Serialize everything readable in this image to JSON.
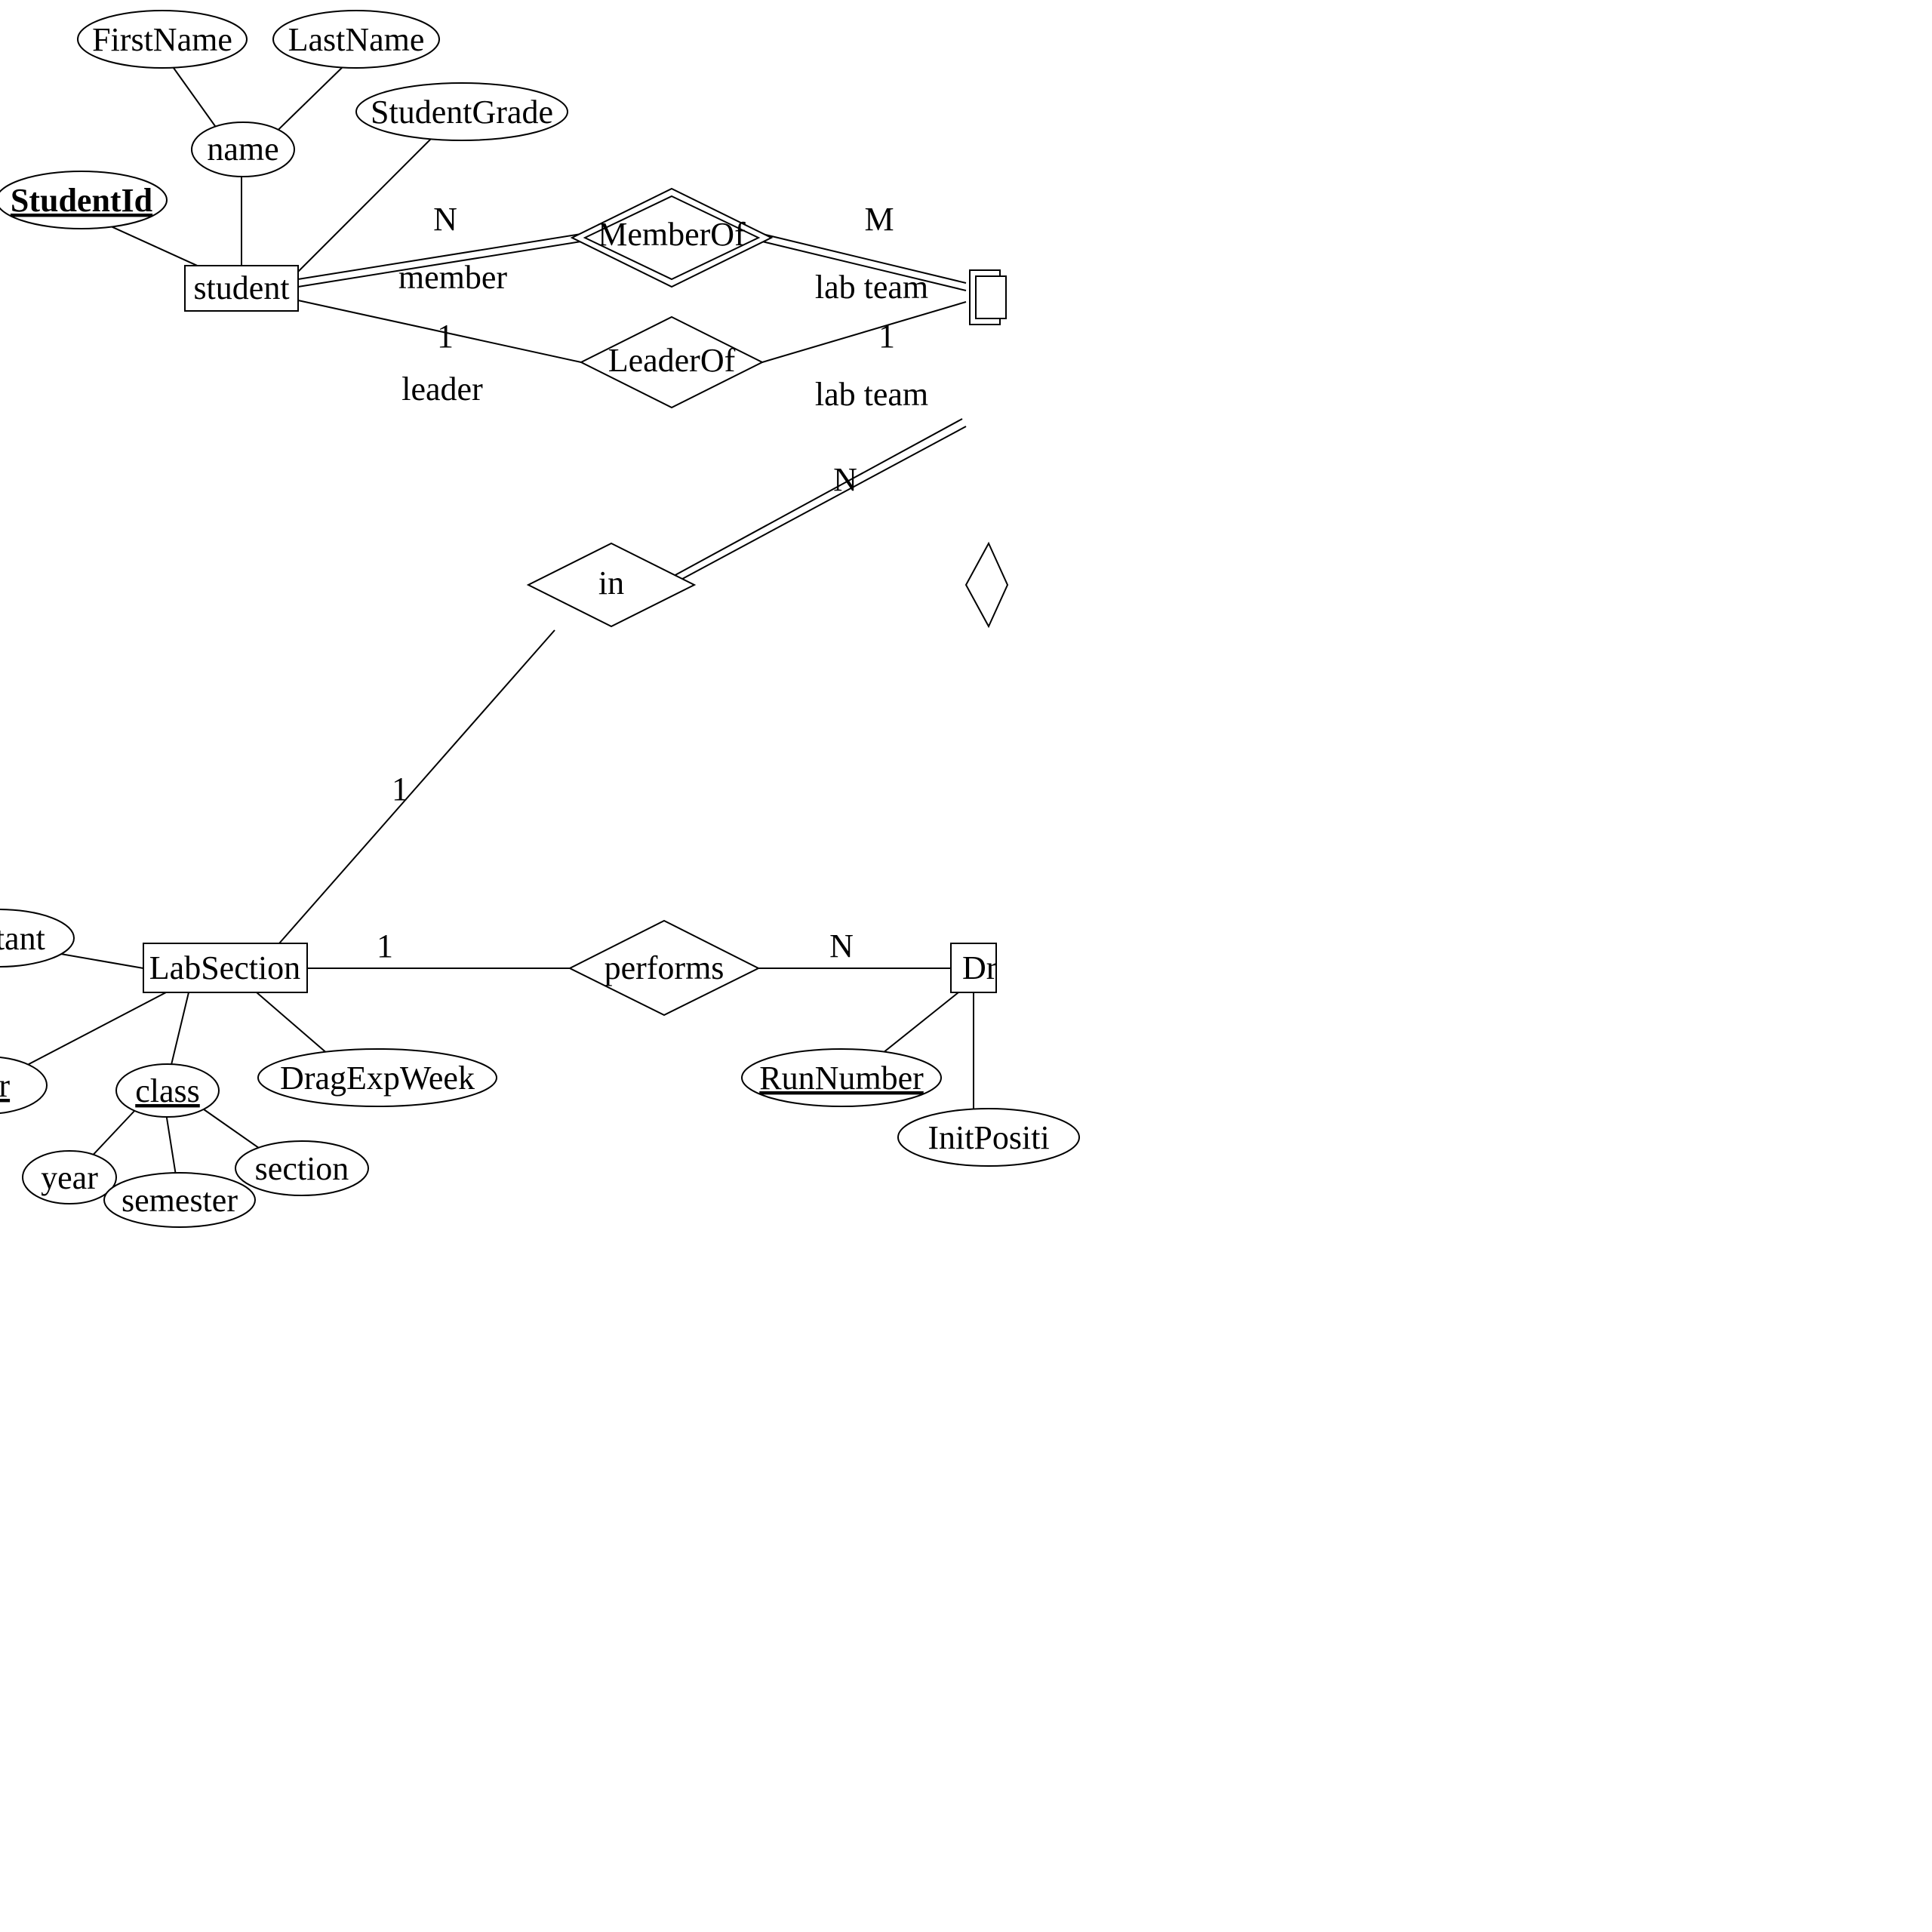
{
  "entities": {
    "student": "student",
    "labsection": "LabSection",
    "dragrun": "DragRun"
  },
  "attributes": {
    "firstname": "FirstName",
    "lastname": "LastName",
    "name": "name",
    "studentid": "StudentId",
    "studentgrade": "StudentGrade",
    "assistant": "assistant",
    "number": "number",
    "class": "class",
    "year": "year",
    "semester": "semester",
    "section": "section",
    "dragexpweek": "DragExpWeek",
    "runnumber": "RunNumber",
    "initposition": "InitPosition"
  },
  "relationships": {
    "memberof": "MemberOf",
    "leaderof": "LeaderOf",
    "in": "in",
    "performs": "performs"
  },
  "labels": {
    "member": "member",
    "leader": "leader",
    "labteam1": "lab team",
    "labteam2": "lab team"
  },
  "cardinalities": {
    "N": "N",
    "M": "M",
    "one": "1"
  }
}
